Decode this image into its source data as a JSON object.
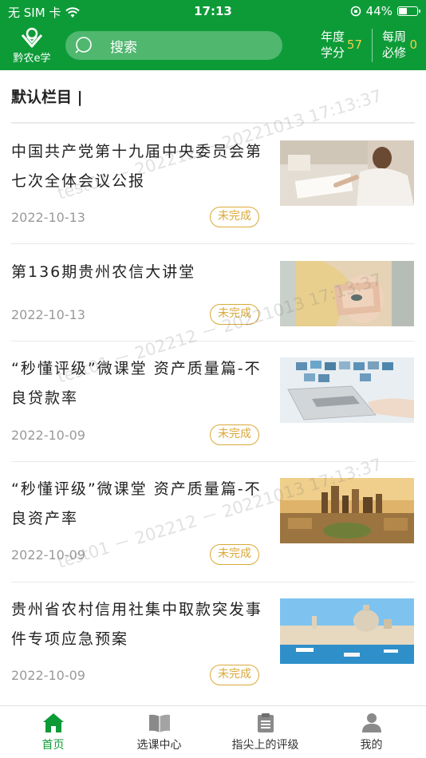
{
  "status_bar": {
    "carrier": "无 SIM 卡",
    "time": "17:13",
    "battery_percent": "44%",
    "battery_level": 0.44
  },
  "header": {
    "logo_text": "黔农e学",
    "search_placeholder": "搜索",
    "annual_credit_label": "年度学分",
    "annual_credit_value": "57",
    "weekly_required_label": "每周必修",
    "weekly_required_value": "0"
  },
  "section": {
    "title": "默认栏目 |"
  },
  "items": [
    {
      "title": "中国共产党第十九届中央委员会第七次全体会议公报",
      "date": "2022-10-13",
      "status": "未完成",
      "image": "woman-writing-at-desk"
    },
    {
      "title": "第136期贵州农信大讲堂",
      "date": "2022-10-13",
      "status": "未完成",
      "image": "woman-framing-eye-with-hands"
    },
    {
      "title": "“秒懂评级”微课堂 资产质量篇-不良贷款率",
      "date": "2022-10-09",
      "status": "未完成",
      "image": "laptop-with-floating-screens"
    },
    {
      "title": "“秒懂评级”微课堂 资产质量篇-不良资产率",
      "date": "2022-10-09",
      "status": "未完成",
      "image": "city-skyline-at-sunset"
    },
    {
      "title": "贵州省农村信用社集中取款突发事件专项应急预案",
      "date": "2022-10-09",
      "status": "未完成",
      "image": "venice-canal-view"
    }
  ],
  "watermark": {
    "text": "test01 － 202212 － 20221013 17:13:37"
  },
  "tabbar": [
    {
      "label": "首页",
      "icon": "home-icon",
      "active": true
    },
    {
      "label": "选课中心",
      "icon": "book-icon",
      "active": false
    },
    {
      "label": "指尖上的评级",
      "icon": "clipboard-icon",
      "active": false
    },
    {
      "label": "我的",
      "icon": "user-icon",
      "active": false
    }
  ],
  "colors": {
    "brand_green": "#0d9b38",
    "badge_gold": "#d9a93a",
    "credit_yellow": "#f5d04a"
  }
}
